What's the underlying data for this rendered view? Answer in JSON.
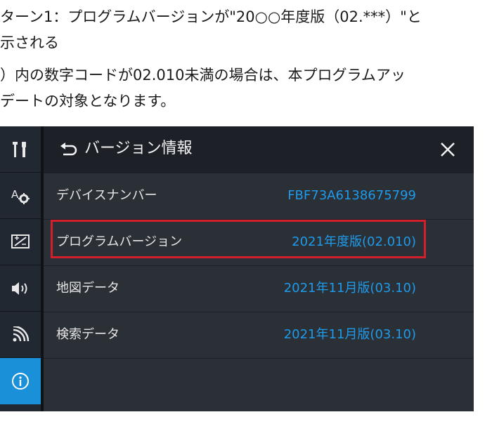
{
  "caption": {
    "line1": "ターン1：プログラムバージョンが\"20○○年度版（02.***）\"と",
    "line2": "示される",
    "line3": "）内の数字コードが02.010未満の場合は、本プログラムアッ",
    "line4": "デートの対象となります。"
  },
  "sidebar": {
    "items": [
      {
        "icon": "tools-icon"
      },
      {
        "icon": "display-settings-icon"
      },
      {
        "icon": "screen-adjust-icon"
      },
      {
        "icon": "speaker-icon"
      },
      {
        "icon": "wireless-icon"
      },
      {
        "icon": "info-icon",
        "active": true
      }
    ]
  },
  "panel": {
    "title": "バージョン情報",
    "rows": [
      {
        "label": "デバイスナンバー",
        "value": "FBF73A6138675799"
      },
      {
        "label": "プログラムバージョン",
        "value": "2021年度版(02.010)",
        "highlighted": true
      },
      {
        "label": "地図データ",
        "value": "2021年11月版(03.10)"
      },
      {
        "label": "検索データ",
        "value": "2021年11月版(03.10)"
      },
      {
        "label": "",
        "value": ""
      }
    ]
  },
  "colors": {
    "accent": "#1a90d9",
    "value_text": "#1e9bea",
    "highlight": "#d21f2b",
    "panel_bg": "#2b2f36",
    "header_bg": "#1d2127"
  }
}
